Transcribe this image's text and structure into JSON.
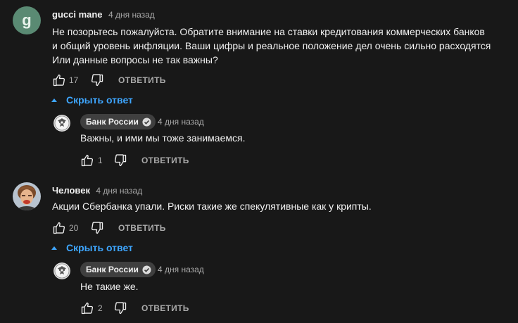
{
  "comments": [
    {
      "author": "gucci mane",
      "avatar_letter": "g",
      "time": "4 дня назад",
      "text": "Не позорьтесь пожалуйста. Обратите внимание на ставки кредитования коммерческих банков\nи общий уровень инфляции. Ваши цифры и реальное положение дел очень сильно расходятся\nИли данные вопросы не так важны?",
      "likes": "17",
      "reply_label": "ОТВЕТИТЬ",
      "toggle_label": "Скрыть ответ",
      "reply": {
        "author": "Банк России",
        "time": "4 дня назад",
        "text": "Важны, и ими мы тоже занимаемся.",
        "likes": "1",
        "reply_label": "ОТВЕТИТЬ"
      }
    },
    {
      "author": "Человек",
      "time": "4 дня назад",
      "text": "Акции Сбербанка упали. Риски такие же спекулятивные как у крипты.",
      "likes": "20",
      "reply_label": "ОТВЕТИТЬ",
      "toggle_label": "Скрыть ответ",
      "reply": {
        "author": "Банк России",
        "time": "4 дня назад",
        "text": "Не такие же.",
        "likes": "2",
        "reply_label": "ОТВЕТИТЬ"
      }
    }
  ],
  "colors": {
    "background": "#181818",
    "link": "#3ea6ff",
    "chip": "#3f3f3f",
    "secondary_text": "#aaaaaa"
  }
}
